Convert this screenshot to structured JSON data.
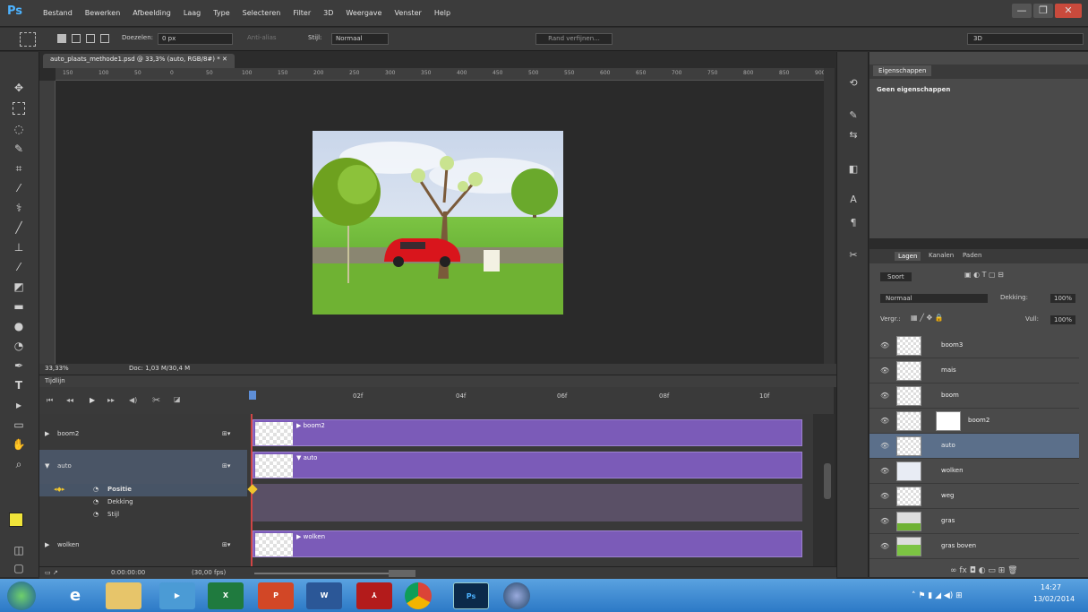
{
  "app": {
    "logo": "Ps"
  },
  "menubar": {
    "items": [
      "Bestand",
      "Bewerken",
      "Afbeelding",
      "Laag",
      "Type",
      "Selecteren",
      "Filter",
      "3D",
      "Weergave",
      "Venster",
      "Help"
    ]
  },
  "window_buttons": {
    "minimize": "—",
    "restore": "❐",
    "close": "✕"
  },
  "options": {
    "feather_label": "Doezelen:",
    "feather_value": "0 px",
    "antialias": "Anti-alias",
    "style_label": "Stijl:",
    "style_value": "Normaal",
    "refine_edge": "Rand verfijnen...",
    "workspace": "3D"
  },
  "document": {
    "tab_title": "auto_plaats_methode1.psd @ 33,3% (auto, RGB/8#) *"
  },
  "ruler": {
    "ticks": [
      "150",
      "100",
      "50",
      "0",
      "50",
      "100",
      "150",
      "200",
      "250",
      "300",
      "350",
      "400",
      "450",
      "500",
      "550",
      "600",
      "650",
      "700",
      "750",
      "800",
      "850",
      "900"
    ]
  },
  "status": {
    "zoom": "33,33%",
    "doc": "Doc: 1,03 M/30,4 M"
  },
  "timeline": {
    "title": "Tijdlijn",
    "ruler_ticks": [
      "02f",
      "04f",
      "06f",
      "08f",
      "10f"
    ],
    "time": "0:00:00:00",
    "fps": "(30,00 fps)",
    "tracks": [
      {
        "name": "boom2",
        "expanded": false
      },
      {
        "name": "auto",
        "expanded": true,
        "props": [
          "Positie",
          "Dekking",
          "Stijl"
        ]
      },
      {
        "name": "wolken",
        "expanded": false
      }
    ],
    "clips": [
      {
        "label": "boom2"
      },
      {
        "label": "auto"
      },
      {
        "label": "wolken"
      }
    ]
  },
  "properties": {
    "tab": "Eigenschappen",
    "subtitle": "Geen eigenschappen"
  },
  "layers": {
    "tabs": [
      "Lagen",
      "Kanalen",
      "Paden"
    ],
    "kind_label": "Soort",
    "blend": "Normaal",
    "opacity_label": "Dekking:",
    "opacity": "100%",
    "lock_label": "Vergr.:",
    "fill_label": "Vull:",
    "fill": "100%",
    "items": [
      {
        "name": "boom3",
        "selected": false
      },
      {
        "name": "mais",
        "selected": false
      },
      {
        "name": "boom",
        "selected": false
      },
      {
        "name": "boom2",
        "selected": false
      },
      {
        "name": "auto",
        "selected": true
      },
      {
        "name": "wolken",
        "selected": false
      },
      {
        "name": "weg",
        "selected": false
      },
      {
        "name": "gras",
        "selected": false
      },
      {
        "name": "gras boven",
        "selected": false
      }
    ]
  },
  "taskbar": {
    "time": "14:27",
    "date": "13/02/2014",
    "apps": [
      "ie",
      "explorer",
      "media",
      "excel",
      "powerpoint",
      "word",
      "acrobat",
      "chrome",
      "photoshop",
      "other"
    ],
    "app_labels": {
      "excel": "X",
      "powerpoint": "P",
      "word": "W",
      "photoshop": "Ps"
    }
  }
}
